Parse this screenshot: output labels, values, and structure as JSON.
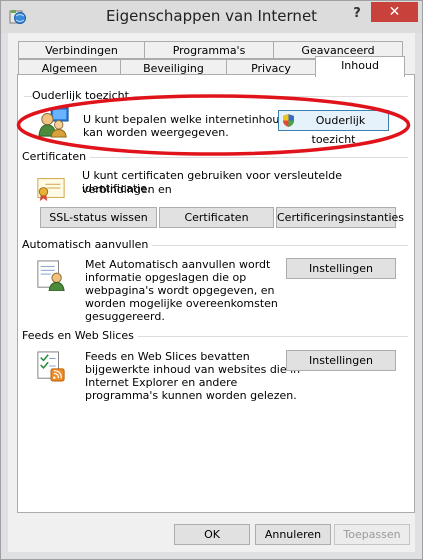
{
  "window": {
    "title": "Eigenschappen van Internet",
    "help_label": "?",
    "close_label": "✕"
  },
  "tabs": {
    "row1": [
      "Verbindingen",
      "Programma's",
      "Geavanceerd"
    ],
    "row2": [
      "Algemeen",
      "Beveiliging",
      "Privacy",
      "Inhoud"
    ],
    "active": "Inhoud"
  },
  "parental": {
    "group_label": "Ouderlijk toezicht",
    "description_line1": "U kunt bepalen welke internetinhoud",
    "description_line2": "kan worden weergegeven.",
    "button_label": "Ouderlijk toezicht",
    "icon": "parental-users-icon",
    "button_icon": "shield-icon"
  },
  "certificates": {
    "group_label": "Certificaten",
    "description_line1": "U kunt certificaten gebruiken voor versleutelde verbindingen en",
    "description_line2": "identificatie.",
    "buttons": [
      "SSL-status wissen",
      "Certificaten",
      "Certificeringsinstanties"
    ],
    "icon": "certificate-icon"
  },
  "autocomplete": {
    "group_label": "Automatisch aanvullen",
    "lines": [
      "Met Automatisch aanvullen wordt",
      "informatie opgeslagen die op",
      "webpagina's wordt opgegeven, en",
      "worden mogelijke overeenkomsten",
      "gesuggereerd."
    ],
    "button_label": "Instellingen",
    "icon": "autocomplete-icon"
  },
  "feeds": {
    "group_label": "Feeds en Web Slices",
    "lines": [
      "Feeds en Web Slices bevatten",
      "bijgewerkte inhoud van websites die in",
      "Internet Explorer en andere",
      "programma's kunnen worden gelezen."
    ],
    "button_label": "Instellingen",
    "icon": "rss-feed-icon"
  },
  "footer": {
    "ok": "OK",
    "cancel": "Annuleren",
    "apply": "Toepassen"
  },
  "annotation_color": "#e0131a"
}
